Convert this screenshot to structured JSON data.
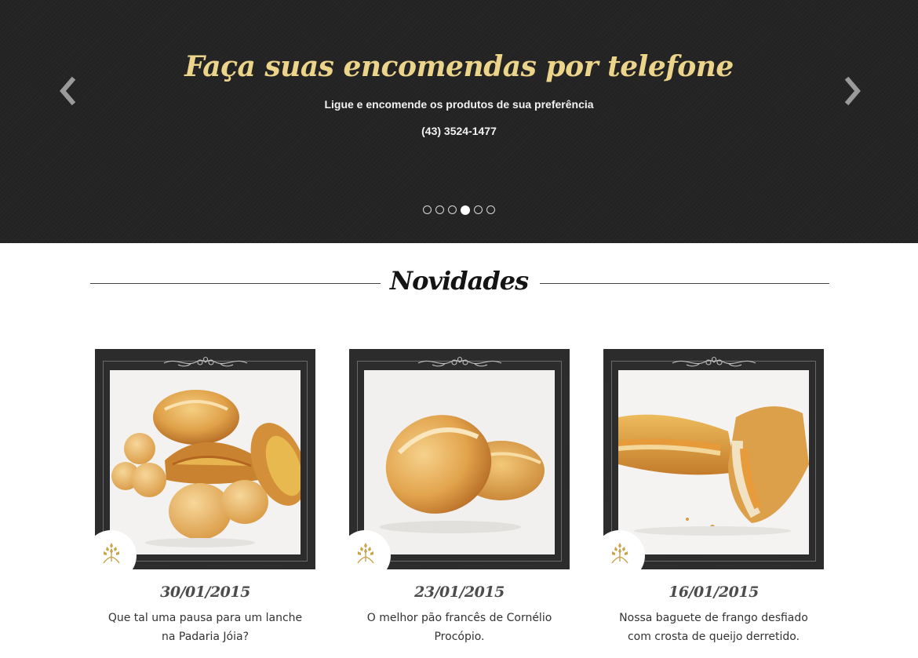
{
  "slider": {
    "title": "Faça suas encomendas por telefone",
    "subtitle": "Ligue e encomende os produtos de sua preferência",
    "phone": "(43) 3524-1477",
    "slide_count": 6,
    "active_slide": 4,
    "colors": {
      "title": "#ecd58a",
      "background": "#242424"
    }
  },
  "novidades": {
    "heading": "Novidades",
    "items": [
      {
        "date": "30/01/2015",
        "text": "Que tal uma pausa para um lanche na Padaria Jóia?",
        "image": "bread-rolls-cheese-bread-photo",
        "icon": "wheat-icon"
      },
      {
        "date": "23/01/2015",
        "text": "O melhor pão francês de Cornélio Procópio.",
        "image": "french-bread-photo",
        "icon": "wheat-icon"
      },
      {
        "date": "16/01/2015",
        "text": "Nossa baguete de frango desfiado com crosta de queijo derretido.",
        "image": "chicken-baguette-photo",
        "icon": "wheat-icon"
      }
    ]
  },
  "icons": {
    "prev": "chevron-left-icon",
    "next": "chevron-right-icon"
  }
}
